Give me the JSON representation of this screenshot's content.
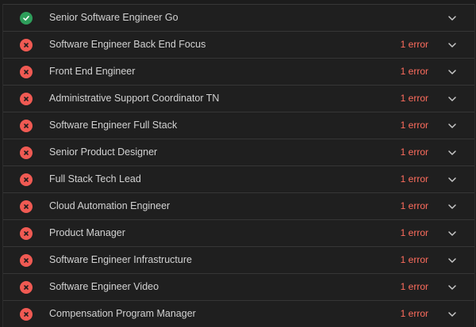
{
  "rows": [
    {
      "title": "Senior Software Engineer Go",
      "status": "success",
      "status_icon": "check-circle-icon",
      "error_text": ""
    },
    {
      "title": "Software Engineer Back End Focus",
      "status": "error",
      "status_icon": "x-circle-icon",
      "error_text": "1 error"
    },
    {
      "title": "Front End Engineer",
      "status": "error",
      "status_icon": "x-circle-icon",
      "error_text": "1 error"
    },
    {
      "title": "Administrative Support Coordinator TN",
      "status": "error",
      "status_icon": "x-circle-icon",
      "error_text": "1 error"
    },
    {
      "title": "Software Engineer Full Stack",
      "status": "error",
      "status_icon": "x-circle-icon",
      "error_text": "1 error"
    },
    {
      "title": "Senior Product Designer",
      "status": "error",
      "status_icon": "x-circle-icon",
      "error_text": "1 error"
    },
    {
      "title": "Full Stack Tech Lead",
      "status": "error",
      "status_icon": "x-circle-icon",
      "error_text": "1 error"
    },
    {
      "title": "Cloud Automation Engineer",
      "status": "error",
      "status_icon": "x-circle-icon",
      "error_text": "1 error"
    },
    {
      "title": "Product Manager",
      "status": "error",
      "status_icon": "x-circle-icon",
      "error_text": "1 error"
    },
    {
      "title": "Software Engineer Infrastructure",
      "status": "error",
      "status_icon": "x-circle-icon",
      "error_text": "1 error"
    },
    {
      "title": "Software Engineer Video",
      "status": "error",
      "status_icon": "x-circle-icon",
      "error_text": "1 error"
    },
    {
      "title": "Compensation Program Manager",
      "status": "error",
      "status_icon": "x-circle-icon",
      "error_text": "1 error"
    }
  ],
  "colors": {
    "success": "#2e9e5b",
    "error": "#f05a53",
    "error_text": "#ff6d5e",
    "title_text": "#d2d2d2",
    "background": "#1c1c1c"
  },
  "chevron_icon": "chevron-down-icon"
}
